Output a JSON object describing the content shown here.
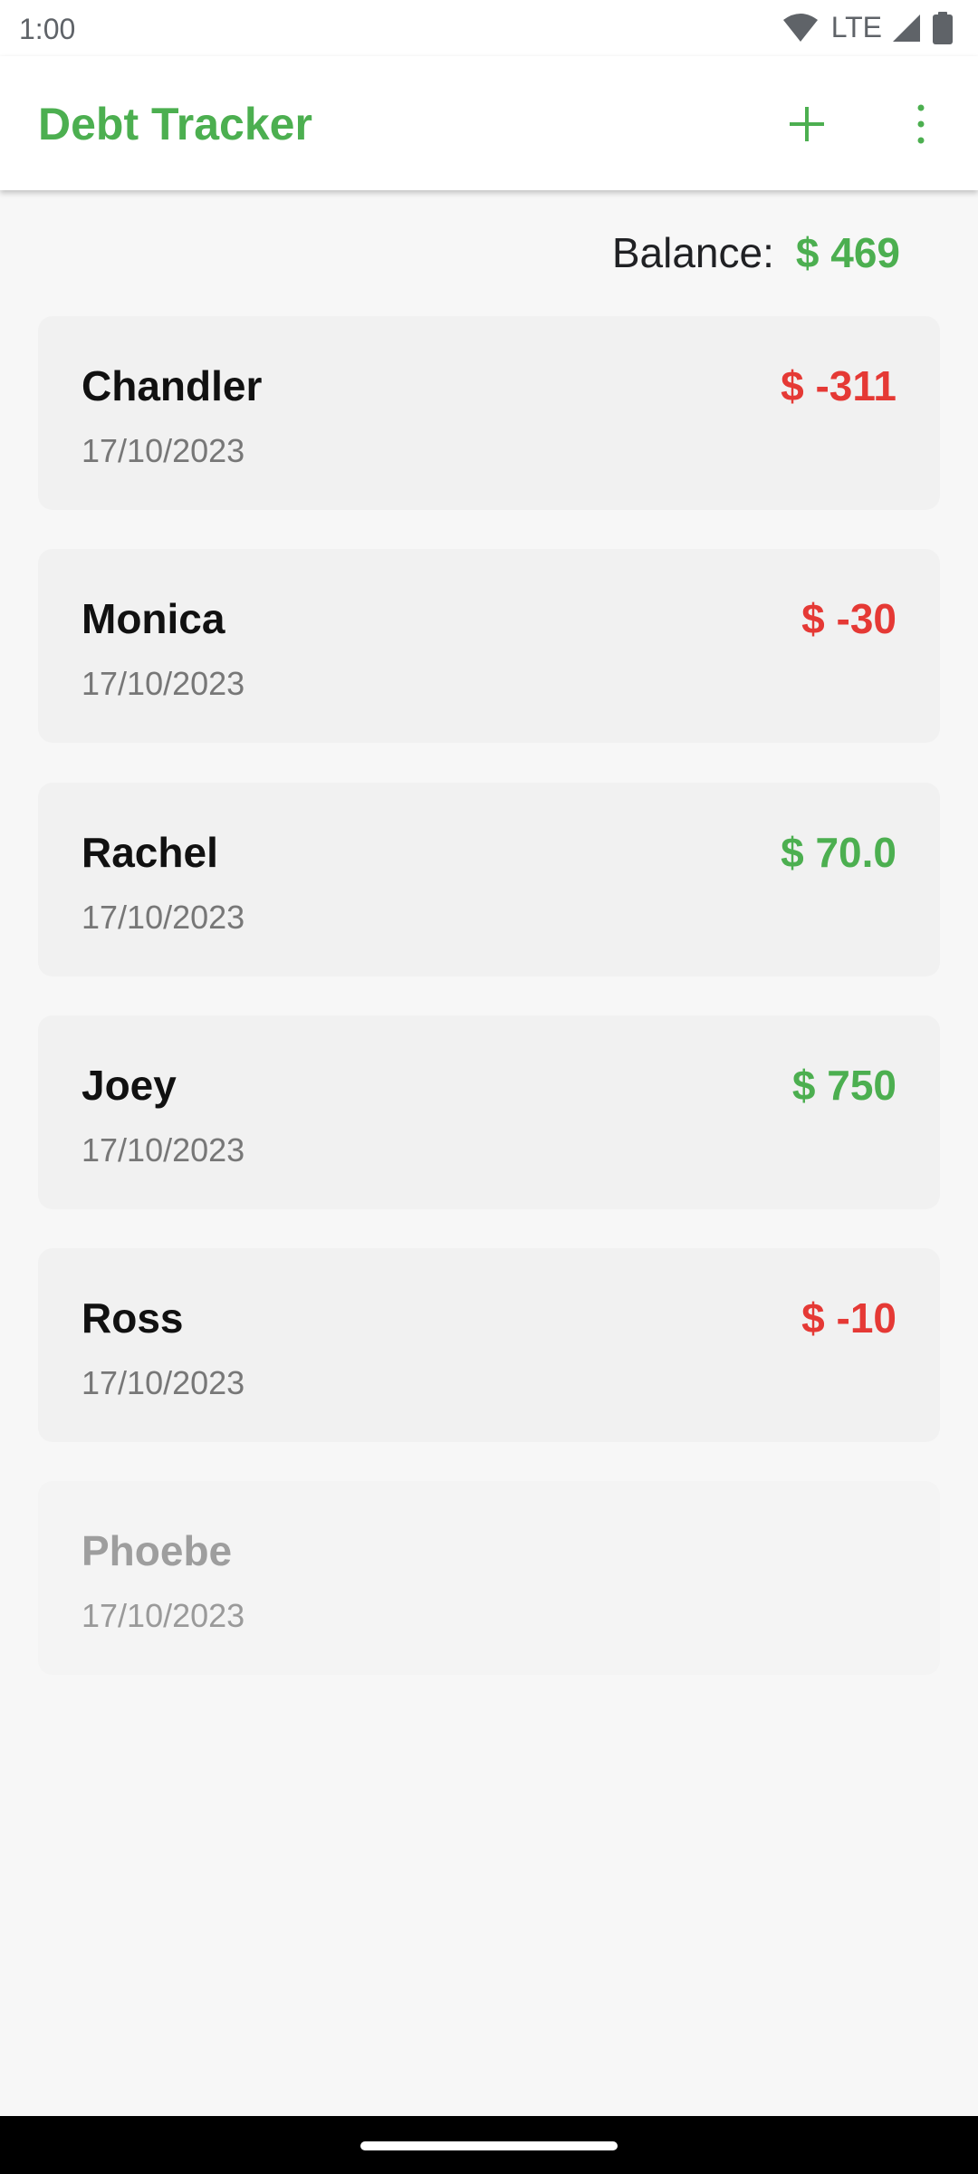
{
  "status_bar": {
    "time": "1:00",
    "network": "LTE",
    "icons": [
      "wifi-icon",
      "cell-signal-icon",
      "battery-icon"
    ]
  },
  "app_bar": {
    "title": "Debt Tracker",
    "actions": [
      "add-icon",
      "more-vert-icon"
    ]
  },
  "balance": {
    "label": "Balance:",
    "value": "$ 469"
  },
  "debts": [
    {
      "name": "Chandler",
      "date": "17/10/2023",
      "amount": "$ -311",
      "status": "negative"
    },
    {
      "name": "Monica",
      "date": "17/10/2023",
      "amount": "$ -30",
      "status": "negative"
    },
    {
      "name": "Rachel",
      "date": "17/10/2023",
      "amount": "$ 70.0",
      "status": "positive"
    },
    {
      "name": "Joey",
      "date": "17/10/2023",
      "amount": "$ 750",
      "status": "positive"
    },
    {
      "name": "Ross",
      "date": "17/10/2023",
      "amount": "$ -10",
      "status": "negative"
    },
    {
      "name": "Phoebe",
      "date": "17/10/2023",
      "amount": "",
      "status": "settled"
    }
  ],
  "colors": {
    "accent": "#4caf50",
    "negative": "#e53935",
    "positive": "#4caf50",
    "card_background": "#f1f1f1",
    "page_background": "#f7f7f7"
  }
}
